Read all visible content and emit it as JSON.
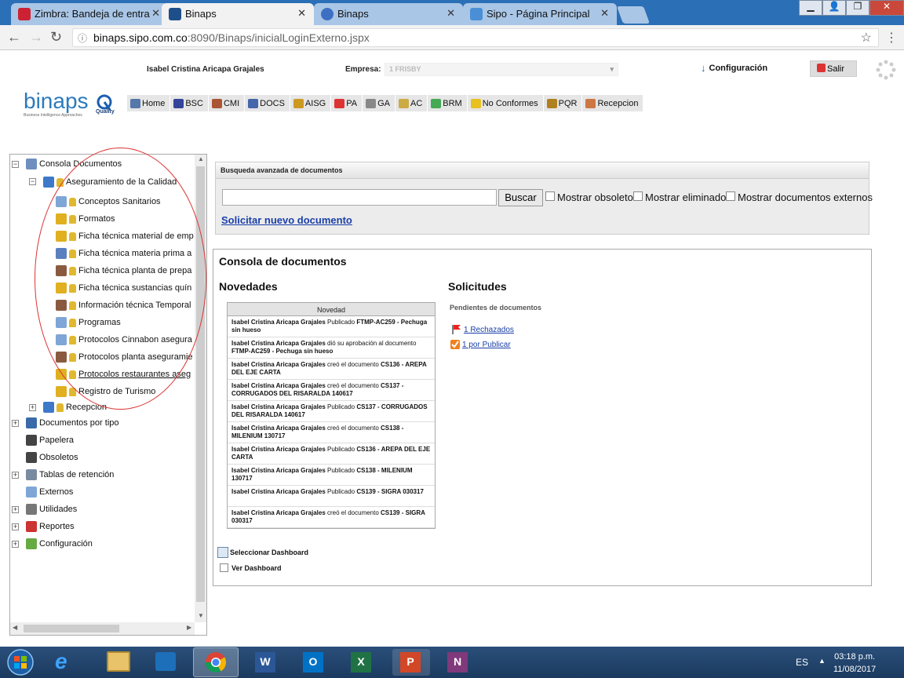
{
  "browser": {
    "tabs": [
      {
        "title": "Zimbra: Bandeja de entra",
        "active": false
      },
      {
        "title": "Binaps",
        "active": true
      },
      {
        "title": "Binaps",
        "active": false
      },
      {
        "title": "Sipo - Página Principal",
        "active": false
      }
    ],
    "url_host": "binaps.sipo.com.co",
    "url_rest": ":8090/Binaps/inicialLoginExterno.jspx"
  },
  "header": {
    "user_name": "Isabel Cristina Aricapa Grajales",
    "empresa_label": "Empresa:",
    "empresa_value": "1 FRISBY",
    "config_label": "Configuración",
    "salir_label": "Salir",
    "logo_text": "binaps",
    "logo_sub": "Business Intelligence Approaches",
    "quality_label": "Quality"
  },
  "menu": [
    {
      "label": "Home",
      "icon": "home-icon",
      "color": "#5577aa"
    },
    {
      "label": "BSC",
      "icon": "bsc-icon",
      "color": "#334499"
    },
    {
      "label": "CMI",
      "icon": "cmi-icon",
      "color": "#aa5533"
    },
    {
      "label": "DOCS",
      "icon": "docs-icon",
      "color": "#4466aa"
    },
    {
      "label": "AISG",
      "icon": "aisg-icon",
      "color": "#cc9922"
    },
    {
      "label": "PA",
      "icon": "pa-icon",
      "color": "#dd3333"
    },
    {
      "label": "GA",
      "icon": "ga-icon",
      "color": "#888888"
    },
    {
      "label": "AC",
      "icon": "ac-icon",
      "color": "#ccaa44"
    },
    {
      "label": "BRM",
      "icon": "brm-icon",
      "color": "#44aa55"
    },
    {
      "label": "No Conformes",
      "icon": "warning-icon",
      "color": "#e8c020"
    },
    {
      "label": "PQR",
      "icon": "pqr-icon",
      "color": "#b08020"
    },
    {
      "label": "Recepcion",
      "icon": "reception-icon",
      "color": "#cc7744"
    }
  ],
  "tree": {
    "root": "Consola Documentos",
    "group": "Aseguramiento de la Calidad",
    "children": [
      "Conceptos Sanitarios",
      "Formatos",
      "Ficha técnica material de emp",
      "Ficha técnica materia prima a",
      "Ficha técnica planta de prepa",
      "Ficha técnica sustancias quín",
      "Información técnica Temporal",
      "Programas",
      "Protocolos Cinnabon asegura",
      "Protocolos planta aseguramie",
      "Protocolos restaurantes aseg",
      "Registro de Turismo"
    ],
    "recepcion": "Recepcion",
    "top_level": [
      "Documentos por tipo",
      "Papelera",
      "Obsoletos",
      "Tablas de retención",
      "Externos",
      "Utilidades",
      "Reportes",
      "Configuración"
    ]
  },
  "search": {
    "header": "Busqueda avanzada de documentos",
    "button": "Buscar",
    "opt_obsoletos": "Mostrar obsoletos",
    "opt_eliminados": "Mostrar eliminados",
    "opt_externos": "Mostrar documentos externos",
    "new_doc_link": "Solicitar nuevo documento"
  },
  "console": {
    "title": "Consola de documentos",
    "novedades_title": "Novedades",
    "novedades_header": "Novedad",
    "novedades": [
      {
        "user": "Isabel Cristina Aricapa Grajales",
        "action": " Publicado ",
        "doc": "FTMP-AC259 - Pechuga sin hueso"
      },
      {
        "user": "Isabel Cristina Aricapa Grajales",
        "action": " dió su aprobación al documento ",
        "doc": "FTMP-AC259 - Pechuga sin hueso"
      },
      {
        "user": "Isabel Cristina Aricapa Grajales",
        "action": " creó el documento ",
        "doc": "CS136 - AREPA DEL EJE CARTA"
      },
      {
        "user": "Isabel Cristina Aricapa Grajales",
        "action": " creó el documento ",
        "doc": "CS137 - CORRUGADOS DEL RISARALDA 140617"
      },
      {
        "user": "Isabel Cristina Aricapa Grajales",
        "action": " Publicado ",
        "doc": "CS137 - CORRUGADOS DEL RISARALDA 140617"
      },
      {
        "user": "Isabel Cristina Aricapa Grajales",
        "action": " creó el documento ",
        "doc": "CS138 - MILENIUM 130717"
      },
      {
        "user": "Isabel Cristina Aricapa Grajales",
        "action": " Publicado ",
        "doc": "CS136 - AREPA DEL EJE CARTA"
      },
      {
        "user": "Isabel Cristina Aricapa Grajales",
        "action": " Publicado ",
        "doc": "CS138 - MILENIUM 130717"
      },
      {
        "user": "Isabel Cristina Aricapa Grajales",
        "action": " Publicado ",
        "doc": "CS139 - SIGRA 030317"
      },
      {
        "user": "Isabel Cristina Aricapa Grajales",
        "action": " creó el documento ",
        "doc": "CS139 - SIGRA 030317"
      }
    ],
    "solicitudes_title": "Solicitudes",
    "pendientes_label": "Pendientes de documentos",
    "rechazados_link": "1 Rechazados",
    "por_publicar_link": "1 por Publicar",
    "seleccionar_dashboard": "Seleccionar Dashboard",
    "ver_dashboard": "Ver Dashboard"
  },
  "taskbar": {
    "lang": "ES",
    "time": "03:18 p.m.",
    "date": "11/08/2017"
  }
}
